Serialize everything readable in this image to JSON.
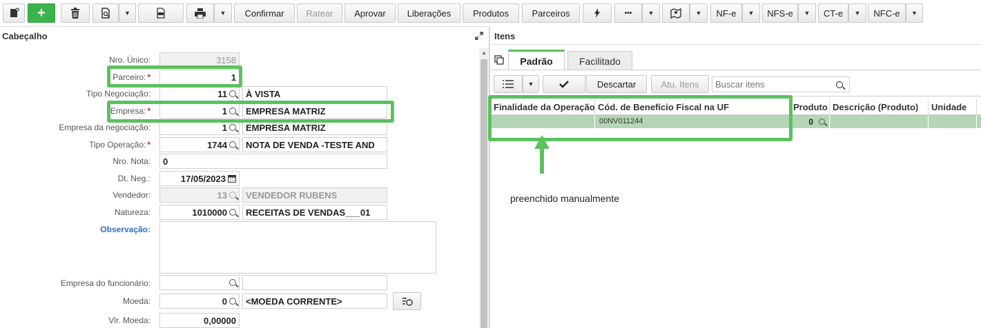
{
  "toolbar": {
    "confirmar": "Confirmar",
    "ratear": "Ratear",
    "aprovar": "Aprovar",
    "liberacoes": "Liberações",
    "produtos": "Produtos",
    "parceiros": "Parceiros",
    "more": "•••",
    "nfe": "NF-e",
    "nfse": "NFS-e",
    "cte": "CT-e",
    "nfce": "NFC-e",
    "add": "+"
  },
  "cabecalho": {
    "title": "Cabeçalho",
    "fields": {
      "nro_unico": {
        "label": "Nro. Único:",
        "value": "3158"
      },
      "parceiro": {
        "label": "Parceiro:",
        "value": "1"
      },
      "tipo_negociacao": {
        "label": "Tipo Negociação:",
        "value": "11",
        "desc": "À VISTA"
      },
      "empresa": {
        "label": "Empresa:",
        "value": "1",
        "desc": "EMPRESA MATRIZ"
      },
      "empresa_negociacao": {
        "label": "Empresa da negociação:",
        "value": "1",
        "desc": "EMPRESA MATRIZ"
      },
      "tipo_operacao": {
        "label": "Tipo Operação:",
        "value": "1744",
        "desc": "NOTA DE VENDA -TESTE AND"
      },
      "nro_nota": {
        "label": "Nro. Nota:",
        "value": "0"
      },
      "dt_neg": {
        "label": "Dt. Neg.:",
        "value": "17/05/2023"
      },
      "vendedor": {
        "label": "Vendedor:",
        "value": "13",
        "desc": "VENDEDOR RUBENS"
      },
      "natureza": {
        "label": "Natureza:",
        "value": "1010000",
        "desc": "RECEITAS DE VENDAS___01"
      },
      "observacao": {
        "label": "Observação:",
        "value": ""
      },
      "empresa_funcionario": {
        "label": "Empresa do funcionário:",
        "value": "",
        "desc": ""
      },
      "moeda": {
        "label": "Moeda:",
        "value": "0",
        "desc": "<MOEDA CORRENTE>"
      },
      "vlr_moeda": {
        "label": "Vlr. Moeda:",
        "value": "0,00000"
      }
    },
    "required_mark": "*"
  },
  "itens": {
    "title": "Itens",
    "tabs": [
      "Padrão",
      "Facilitado"
    ],
    "descartar": "Descartar",
    "atu_itens": "Atu. Itens",
    "search_placeholder": "Buscar itens",
    "columns": [
      "Finalidade da Operação",
      "Cód. de Benefício Fiscal na UF",
      "Produto",
      "Descrição (Produto)",
      "Unidade"
    ],
    "row": {
      "finalidade": "",
      "cod_beneficio": "00NV011244",
      "produto": "0",
      "descricao": "",
      "unidade": ""
    },
    "annotation": "preenchido manualmente"
  },
  "colors": {
    "highlight": "#5cc15f",
    "row_selected": "#b5d6b4",
    "add_button": "#3cb44b"
  }
}
